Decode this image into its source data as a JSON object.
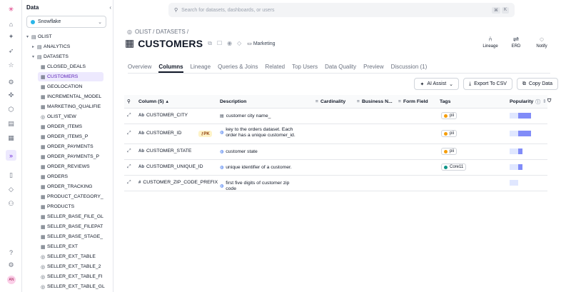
{
  "rail": {
    "icons": [
      {
        "name": "logo-icon",
        "glyph": "✳"
      },
      {
        "name": "home-icon",
        "glyph": "⌂"
      },
      {
        "name": "sparkle-icon",
        "glyph": "✦"
      },
      {
        "name": "rocket-icon",
        "glyph": "➶"
      },
      {
        "name": "star-icon",
        "glyph": "☆"
      },
      {
        "name": "lineage-icon",
        "glyph": "⚙"
      },
      {
        "name": "dbt-icon",
        "glyph": "✜"
      },
      {
        "name": "cube-icon",
        "glyph": "⬡"
      },
      {
        "name": "layers-icon",
        "glyph": "▤"
      },
      {
        "name": "database-icon",
        "glyph": "▦"
      },
      {
        "name": "expand-icon",
        "glyph": "»"
      },
      {
        "name": "book-icon",
        "glyph": "▯"
      },
      {
        "name": "tag-icon",
        "glyph": "◇"
      },
      {
        "name": "users-icon",
        "glyph": "⚇"
      },
      {
        "name": "help-icon",
        "glyph": "?"
      },
      {
        "name": "settings-icon",
        "glyph": "⚙"
      }
    ],
    "avatar": "AN"
  },
  "tree": {
    "title": "Data",
    "source": "Snowflake",
    "items": [
      {
        "label": "OLIST",
        "level": 0,
        "caret": "▾",
        "icon": "▤"
      },
      {
        "label": "ANALYTICS",
        "level": 1,
        "caret": "▸",
        "icon": "▤"
      },
      {
        "label": "DATASETS",
        "level": 1,
        "caret": "▾",
        "icon": "▤"
      },
      {
        "label": "CLOSED_DEALS",
        "level": 2,
        "icon": "▦"
      },
      {
        "label": "CUSTOMERS",
        "level": 2,
        "icon": "▦",
        "selected": true
      },
      {
        "label": "GEOLOCATION",
        "level": 2,
        "icon": "▦"
      },
      {
        "label": "INCREMENTAL_MODEL",
        "level": 2,
        "icon": "▦"
      },
      {
        "label": "MARKETING_QUALIFIE",
        "level": 2,
        "icon": "▦"
      },
      {
        "label": "OLIST_VIEW",
        "level": 2,
        "icon": "◎"
      },
      {
        "label": "ORDER_ITEMS",
        "level": 2,
        "icon": "▦"
      },
      {
        "label": "ORDER_ITEMS_P",
        "level": 2,
        "icon": "▦"
      },
      {
        "label": "ORDER_PAYMENTS",
        "level": 2,
        "icon": "▦"
      },
      {
        "label": "ORDER_PAYMENTS_P",
        "level": 2,
        "icon": "▦"
      },
      {
        "label": "ORDER_REVIEWS",
        "level": 2,
        "icon": "▦"
      },
      {
        "label": "ORDERS",
        "level": 2,
        "icon": "▦"
      },
      {
        "label": "ORDER_TRACKING",
        "level": 2,
        "icon": "▦"
      },
      {
        "label": "PRODUCT_CATEGORY_",
        "level": 2,
        "icon": "▦"
      },
      {
        "label": "PRODUCTS",
        "level": 2,
        "icon": "▦"
      },
      {
        "label": "SELLER_BASE_FILE_GL",
        "level": 2,
        "icon": "▦"
      },
      {
        "label": "SELLER_BASE_FILEPAT",
        "level": 2,
        "icon": "▦"
      },
      {
        "label": "SELLER_BASE_STAGE_",
        "level": 2,
        "icon": "▦"
      },
      {
        "label": "SELLER_EXT",
        "level": 2,
        "icon": "▦"
      },
      {
        "label": "SELLER_EXT_TABLE",
        "level": 2,
        "icon": "◎"
      },
      {
        "label": "SELLER_EXT_TABLE_2",
        "level": 2,
        "icon": "◎"
      },
      {
        "label": "SELLER_EXT_TABLE_FI",
        "level": 2,
        "icon": "◎"
      },
      {
        "label": "SELLER_EXT_TABLE_GL",
        "level": 2,
        "icon": "◎"
      }
    ]
  },
  "search": {
    "placeholder": "Search for datasets, dashboards, or users",
    "kbd1": "⌘",
    "kbd2": "K"
  },
  "breadcrumb": "OLIST / DATASETS /",
  "page": {
    "title": "CUSTOMERS",
    "tag": "Marketing"
  },
  "top_actions": [
    {
      "name": "lineage-action",
      "label": "Lineage",
      "glyph": "⑃"
    },
    {
      "name": "erd-action",
      "label": "ERD",
      "glyph": "⇌"
    },
    {
      "name": "notify-action",
      "label": "Notify",
      "glyph": "◌"
    }
  ],
  "tabs": [
    "Overview",
    "Columns",
    "Lineage",
    "Queries & Joins",
    "Related",
    "Top Users",
    "Data Quality",
    "Preview",
    "Discussion (1)"
  ],
  "active_tab": "Columns",
  "buttons": {
    "ai_assist": "AI Assist",
    "export": "Export To CSV",
    "copy": "Copy Data"
  },
  "table": {
    "headers": {
      "column": "Column (5)",
      "description": "Description",
      "cardinality": "Cardinality",
      "business": "Business N...",
      "form": "Form Field",
      "tags": "Tags",
      "popularity": "Popularity"
    },
    "rows": [
      {
        "type": "Ab",
        "name": "CUSTOMER_CITY",
        "pk": "",
        "desc": "customer city name_",
        "desc_icon": "doc",
        "tag": "pii",
        "tag_color": "#f59e0b",
        "pop": [
          1,
          1,
          2,
          2,
          2
        ]
      },
      {
        "type": "Ab",
        "name": "CUSTOMER_ID",
        "pk": "PK",
        "desc": "key to the orders dataset. Each order has a unique customer_id.",
        "desc_icon": "globe",
        "tag": "pii",
        "tag_color": "#f59e0b",
        "pop": [
          1,
          1,
          2,
          2,
          2
        ]
      },
      {
        "type": "Ab",
        "name": "CUSTOMER_STATE",
        "pk": "",
        "desc": "customer state",
        "desc_icon": "globe",
        "tag": "pii",
        "tag_color": "#f59e0b",
        "pop": [
          1,
          1,
          2,
          0,
          0
        ]
      },
      {
        "type": "Ab",
        "name": "CUSTOMER_UNIQUE_ID",
        "pk": "",
        "desc": "unique identifier of a customer.",
        "desc_icon": "globe",
        "tag": "Core11",
        "tag_color": "#0d9488",
        "pop": [
          1,
          1,
          2,
          0,
          0
        ]
      },
      {
        "type": "#",
        "name": "CUSTOMER_ZIP_CODE_PREFIX",
        "pk": "",
        "desc": "first five digits of customer zip code",
        "desc_icon": "globe",
        "tag": "",
        "tag_color": "",
        "pop": [
          1,
          1,
          0,
          0,
          0
        ]
      }
    ]
  }
}
